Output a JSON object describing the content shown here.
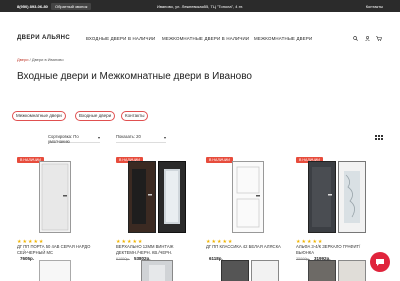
{
  "topbar": {
    "phone": "8(950) 893-06-80",
    "callback_label": "Обратный звонок",
    "address": "Иваново, ул. Лежневская55, ТЦ \"Топола\", 4 эт.",
    "contacts_label": "Контакты"
  },
  "header": {
    "logo": "ДВЕРИ АЛЬЯНС",
    "nav": [
      "ВХОДНЫЕ ДВЕРИ В НАЛИЧИИ",
      "МЕЖКОМНАТНЫЕ ДВЕРИ В НАЛИЧИИ",
      "МЕЖКОМНАТНЫЕ ДВЕРИ"
    ],
    "icons": [
      "search-icon",
      "user-icon",
      "cart-icon"
    ]
  },
  "breadcrumb": {
    "home": "Двери",
    "separator": "/",
    "current": "Двери в Иваново"
  },
  "page_title": "Входные двери и Межкомнатные двери в Иваново",
  "chips": [
    "Межкомнатные двери",
    "Входные двери",
    "Контакты"
  ],
  "toolbar": {
    "sort_label": "Сортировка: По умолчанию",
    "show_label": "Показать: 20"
  },
  "products": [
    {
      "badge": "В НАЛИЧИИ",
      "name": "ДГ ПП ПОРТА 50 4АВ СЕРАЯ НАРДО СЕЙ-ЧЕРНЫЙ МС",
      "old_price": "",
      "price": "7605р."
    },
    {
      "badge": "В НАЛИЧИИ",
      "name": "ВЕРХАЛЬНО 12ММ ВИНТАЖ ДЕКТЕМН./ЧЕРН. КВ./ЧЕРН.",
      "old_price": "61950р.",
      "price": "53802р."
    },
    {
      "badge": "В НАЛИЧИИ",
      "name": "ДГ ПП КЛАССИКА 42 БЕЛАЯ АЛЯСКА",
      "old_price": "",
      "price": "6118р."
    },
    {
      "badge": "В НАЛИЧИИ",
      "name": "АЛЬФА 3-4/К ЗЕРКАЛО ГРАФИТ/ВЬЮНКА",
      "old_price": "35999р.",
      "price": "31992р."
    }
  ],
  "rating": "★★★★★",
  "colors": {
    "accent": "#e0243c",
    "topbar": "#2b2b2b",
    "badge": "#e74c3c"
  }
}
